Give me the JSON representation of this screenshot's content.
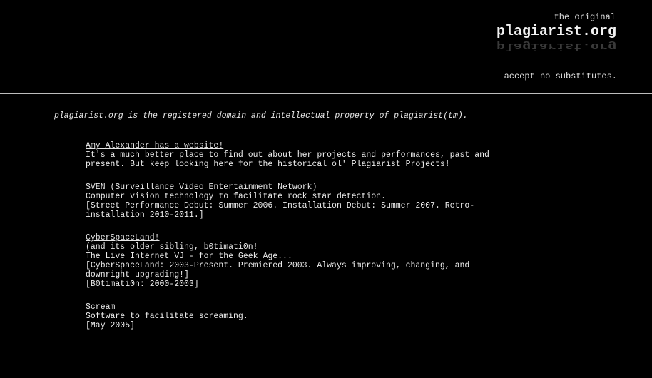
{
  "header": {
    "tagline_top": "the original",
    "logo": "plagiarist.org",
    "slogan": "accept no substitutes."
  },
  "intro": "plagiarist.org is the registered domain and intellectual property of plagiarist(tm).",
  "entries": [
    {
      "links": [
        "Amy Alexander has a website!"
      ],
      "lines": [
        "It's a much better place to find out about her projects and performances, past and",
        "present. But keep looking here for the historical ol' Plagiarist Projects!"
      ]
    },
    {
      "links": [
        "SVEN (Surveillance Video Entertainment Network)"
      ],
      "lines": [
        "Computer vision technology to facilitate rock star detection.",
        "[Street Performance Debut: Summer 2006. Installation Debut: Summer 2007. Retro-",
        "installation 2010-2011.]"
      ]
    },
    {
      "links": [
        "CyberSpaceLand! ",
        "(and its older sibling, b0timati0n!"
      ],
      "lines": [
        "The Live Internet VJ - for the Geek Age...",
        "[CyberSpaceLand: 2003-Present. Premiered 2003. Always improving, changing, and",
        "downright upgrading!]",
        "[B0timati0n: 2000-2003]"
      ]
    },
    {
      "links": [
        "Scream"
      ],
      "lines": [
        "Software to facilitate screaming.",
        "[May 2005]"
      ]
    }
  ]
}
